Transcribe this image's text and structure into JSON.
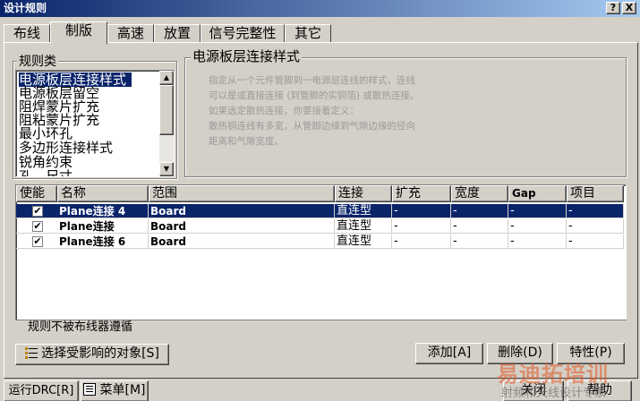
{
  "window": {
    "title": "设计规则",
    "help_btn": "?",
    "close_btn": "X"
  },
  "tabs": [
    {
      "label": "布线"
    },
    {
      "label": "制版"
    },
    {
      "label": "高速"
    },
    {
      "label": "放置"
    },
    {
      "label": "信号完整性"
    },
    {
      "label": "其它"
    }
  ],
  "rule_class": {
    "label": "规则类",
    "items": [
      "电源板层连接样式",
      "电源板层留空",
      "阻焊蒙片扩充",
      "阻粘蒙片扩充",
      "最小环孔",
      "多边形连接样式",
      "锐角约束",
      "孔…尺寸"
    ],
    "selected_index": 0
  },
  "description": {
    "label": "电源板层连接样式",
    "lines": [
      "指定从一个元件管脚到一电源层连线的样式，连线",
      "可以是或直接连接 (到管脚的实铜箔) 或散热连接。",
      "如果选定散热连接，你要接着定义：",
      "散热铜连线有多宽，从管脚边缘到气隙边缘的径向",
      "距离和气隙宽度。"
    ]
  },
  "table": {
    "headers": [
      "使能",
      "名称",
      "范围",
      "连接",
      "扩充",
      "宽度",
      "Gap",
      "项目"
    ],
    "rows": [
      {
        "enabled": "✔",
        "name": "Plane连接 4",
        "scope": "Board",
        "connect": "直连型",
        "expand": "-",
        "width": "-",
        "gap": "-",
        "item": "-"
      },
      {
        "enabled": "✔",
        "name": "Plane连接",
        "scope": "Board",
        "connect": "直连型",
        "expand": "-",
        "width": "-",
        "gap": "-",
        "item": "-"
      },
      {
        "enabled": "✔",
        "name": "Plane连接 6",
        "scope": "Board",
        "connect": "直连型",
        "expand": "-",
        "width": "-",
        "gap": "-",
        "item": "-"
      }
    ],
    "selected_row": 0,
    "footer": "规则不被布线器遵循"
  },
  "buttons": {
    "select_affected": "选择受影响的对象[S]",
    "add": "添加[A]",
    "delete": "删除(D)",
    "properties": "特性(P)",
    "run_drc": "运行DRC[R]",
    "menu": "菜单[M]",
    "close": "关闭",
    "help": "帮助"
  },
  "watermark": {
    "text": "易迪拓培训",
    "subtext": "射频和天线设计专家"
  }
}
